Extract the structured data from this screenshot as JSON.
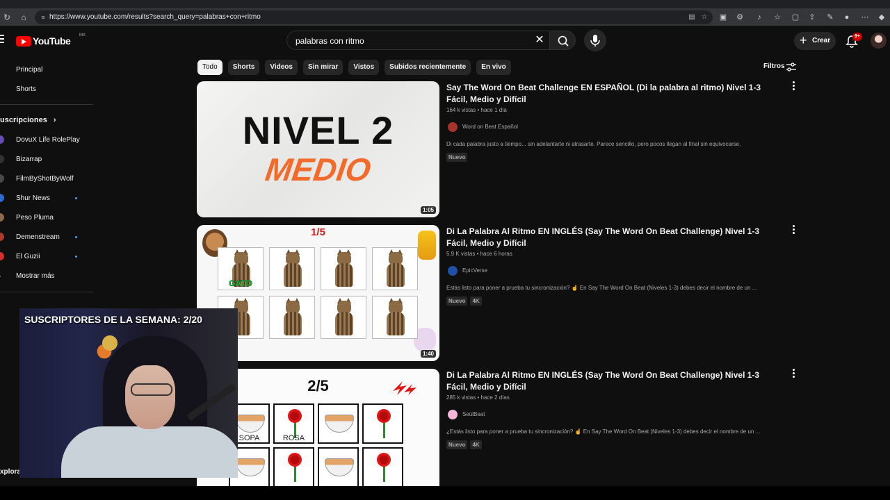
{
  "browser": {
    "url": "https://www.youtube.com/results?search_query=palabras+con+ritmo"
  },
  "masthead": {
    "logo_text": "YouTube",
    "country": "MX",
    "search_value": "palabras con ritmo",
    "create_label": "Crear",
    "notifications_badge": "9+",
    "brand_color": "#ff0000"
  },
  "sidebar": {
    "main_items": [
      {
        "label": "Principal",
        "icon": "home-icon"
      },
      {
        "label": "Shorts",
        "icon": "shorts-icon"
      }
    ],
    "subscriptions_heading": "uscripciones",
    "subscriptions": [
      {
        "label": "DovuX Life RolePlay",
        "dot": false,
        "color": "#6a4bb5"
      },
      {
        "label": "Bizarrap",
        "dot": false,
        "color": "#333333"
      },
      {
        "label": "FilmByShotByWolf",
        "dot": false,
        "color": "#4a4a4a"
      },
      {
        "label": "Shur News",
        "dot": true,
        "color": "#2a6bd1"
      },
      {
        "label": "Peso Pluma",
        "dot": false,
        "color": "#8a6a50"
      },
      {
        "label": "Demenstream",
        "dot": true,
        "color": "#b03a2e"
      },
      {
        "label": "El Guzii",
        "dot": true,
        "color": "#d62d2d"
      }
    ],
    "show_more": "Mostrar más",
    "explore_heading": "xplorar"
  },
  "filters": {
    "chips": [
      "Todo",
      "Shorts",
      "Videos",
      "Sin mirar",
      "Vistos",
      "Subidos recientemente",
      "En vivo"
    ],
    "active_chip": "Todo",
    "filters_label": "Filtros"
  },
  "results": [
    {
      "title": "Say The Word On Beat Challenge EN ESPAÑOL (Di la palabra al ritmo) Nivel 1-3 Fácil, Medio y Difícil",
      "meta": "164 k vistas • hace 1 día",
      "channel": "Word on Beat Español",
      "description": "Di cada palabra justo a tiempo... sin adelantarte ni atrasarte. Parece sencillo, pero pocos llegan al final sin equivocarse.",
      "badges": [
        "Nuevo"
      ],
      "duration": "1:05",
      "thumb_text_1": "NIVEL 2",
      "thumb_text_2": "MEDIO"
    },
    {
      "title": "Di La Palabra Al Ritmo EN INGLÉS (Say The Word On Beat Challenge) Nivel 1-3 Fácil, Medio y Difícil",
      "meta": "5.9 K vistas • hace 6 horas",
      "channel": "EpicVerse",
      "description": "Estás listo para poner a prueba tu sincronización? ☝ En Say The Word On Beat (Niveles 1-3) debes decir el nombre de un ...",
      "badges": [
        "Nuevo",
        "4K"
      ],
      "duration": "1:40",
      "thumb_text_1": "1/5",
      "thumb_word": "GATO"
    },
    {
      "title": "Di La Palabra Al Ritmo EN INGLÉS (Say The Word On Beat Challenge) Nivel 1-3 Fácil, Medio y Difícil",
      "meta": "285 k vistas • hace 2 días",
      "channel": "SeúlBeat",
      "description": "¿Estás listo para poner a prueba tu sincronización? ☝ En Say The Word On Beat (Niveles 1-3) debes decir el nombre de un ...",
      "badges": [
        "Nuevo",
        "4K"
      ],
      "thumb_text_1": "2/5",
      "thumb_word_1": "SOPA",
      "thumb_word_2": "ROSA"
    }
  ],
  "overlay": {
    "banner": "SUSCRIPTORES DE LA SEMANA: 2/20"
  }
}
